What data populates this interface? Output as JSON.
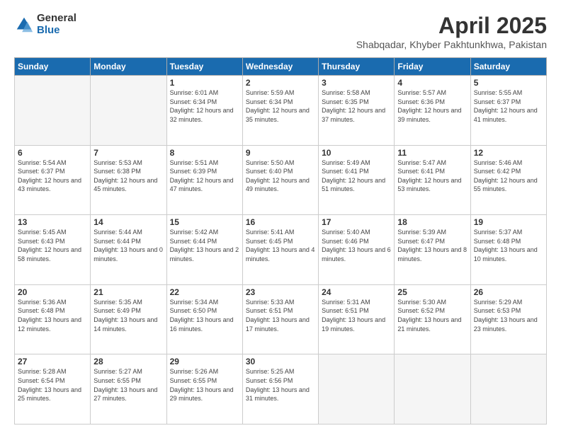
{
  "logo": {
    "general": "General",
    "blue": "Blue"
  },
  "title": "April 2025",
  "subtitle": "Shabqadar, Khyber Pakhtunkhwa, Pakistan",
  "weekdays": [
    "Sunday",
    "Monday",
    "Tuesday",
    "Wednesday",
    "Thursday",
    "Friday",
    "Saturday"
  ],
  "weeks": [
    [
      {
        "day": "",
        "info": ""
      },
      {
        "day": "",
        "info": ""
      },
      {
        "day": "1",
        "info": "Sunrise: 6:01 AM\nSunset: 6:34 PM\nDaylight: 12 hours and 32 minutes."
      },
      {
        "day": "2",
        "info": "Sunrise: 5:59 AM\nSunset: 6:34 PM\nDaylight: 12 hours and 35 minutes."
      },
      {
        "day": "3",
        "info": "Sunrise: 5:58 AM\nSunset: 6:35 PM\nDaylight: 12 hours and 37 minutes."
      },
      {
        "day": "4",
        "info": "Sunrise: 5:57 AM\nSunset: 6:36 PM\nDaylight: 12 hours and 39 minutes."
      },
      {
        "day": "5",
        "info": "Sunrise: 5:55 AM\nSunset: 6:37 PM\nDaylight: 12 hours and 41 minutes."
      }
    ],
    [
      {
        "day": "6",
        "info": "Sunrise: 5:54 AM\nSunset: 6:37 PM\nDaylight: 12 hours and 43 minutes."
      },
      {
        "day": "7",
        "info": "Sunrise: 5:53 AM\nSunset: 6:38 PM\nDaylight: 12 hours and 45 minutes."
      },
      {
        "day": "8",
        "info": "Sunrise: 5:51 AM\nSunset: 6:39 PM\nDaylight: 12 hours and 47 minutes."
      },
      {
        "day": "9",
        "info": "Sunrise: 5:50 AM\nSunset: 6:40 PM\nDaylight: 12 hours and 49 minutes."
      },
      {
        "day": "10",
        "info": "Sunrise: 5:49 AM\nSunset: 6:41 PM\nDaylight: 12 hours and 51 minutes."
      },
      {
        "day": "11",
        "info": "Sunrise: 5:47 AM\nSunset: 6:41 PM\nDaylight: 12 hours and 53 minutes."
      },
      {
        "day": "12",
        "info": "Sunrise: 5:46 AM\nSunset: 6:42 PM\nDaylight: 12 hours and 55 minutes."
      }
    ],
    [
      {
        "day": "13",
        "info": "Sunrise: 5:45 AM\nSunset: 6:43 PM\nDaylight: 12 hours and 58 minutes."
      },
      {
        "day": "14",
        "info": "Sunrise: 5:44 AM\nSunset: 6:44 PM\nDaylight: 13 hours and 0 minutes."
      },
      {
        "day": "15",
        "info": "Sunrise: 5:42 AM\nSunset: 6:44 PM\nDaylight: 13 hours and 2 minutes."
      },
      {
        "day": "16",
        "info": "Sunrise: 5:41 AM\nSunset: 6:45 PM\nDaylight: 13 hours and 4 minutes."
      },
      {
        "day": "17",
        "info": "Sunrise: 5:40 AM\nSunset: 6:46 PM\nDaylight: 13 hours and 6 minutes."
      },
      {
        "day": "18",
        "info": "Sunrise: 5:39 AM\nSunset: 6:47 PM\nDaylight: 13 hours and 8 minutes."
      },
      {
        "day": "19",
        "info": "Sunrise: 5:37 AM\nSunset: 6:48 PM\nDaylight: 13 hours and 10 minutes."
      }
    ],
    [
      {
        "day": "20",
        "info": "Sunrise: 5:36 AM\nSunset: 6:48 PM\nDaylight: 13 hours and 12 minutes."
      },
      {
        "day": "21",
        "info": "Sunrise: 5:35 AM\nSunset: 6:49 PM\nDaylight: 13 hours and 14 minutes."
      },
      {
        "day": "22",
        "info": "Sunrise: 5:34 AM\nSunset: 6:50 PM\nDaylight: 13 hours and 16 minutes."
      },
      {
        "day": "23",
        "info": "Sunrise: 5:33 AM\nSunset: 6:51 PM\nDaylight: 13 hours and 17 minutes."
      },
      {
        "day": "24",
        "info": "Sunrise: 5:31 AM\nSunset: 6:51 PM\nDaylight: 13 hours and 19 minutes."
      },
      {
        "day": "25",
        "info": "Sunrise: 5:30 AM\nSunset: 6:52 PM\nDaylight: 13 hours and 21 minutes."
      },
      {
        "day": "26",
        "info": "Sunrise: 5:29 AM\nSunset: 6:53 PM\nDaylight: 13 hours and 23 minutes."
      }
    ],
    [
      {
        "day": "27",
        "info": "Sunrise: 5:28 AM\nSunset: 6:54 PM\nDaylight: 13 hours and 25 minutes."
      },
      {
        "day": "28",
        "info": "Sunrise: 5:27 AM\nSunset: 6:55 PM\nDaylight: 13 hours and 27 minutes."
      },
      {
        "day": "29",
        "info": "Sunrise: 5:26 AM\nSunset: 6:55 PM\nDaylight: 13 hours and 29 minutes."
      },
      {
        "day": "30",
        "info": "Sunrise: 5:25 AM\nSunset: 6:56 PM\nDaylight: 13 hours and 31 minutes."
      },
      {
        "day": "",
        "info": ""
      },
      {
        "day": "",
        "info": ""
      },
      {
        "day": "",
        "info": ""
      }
    ]
  ]
}
